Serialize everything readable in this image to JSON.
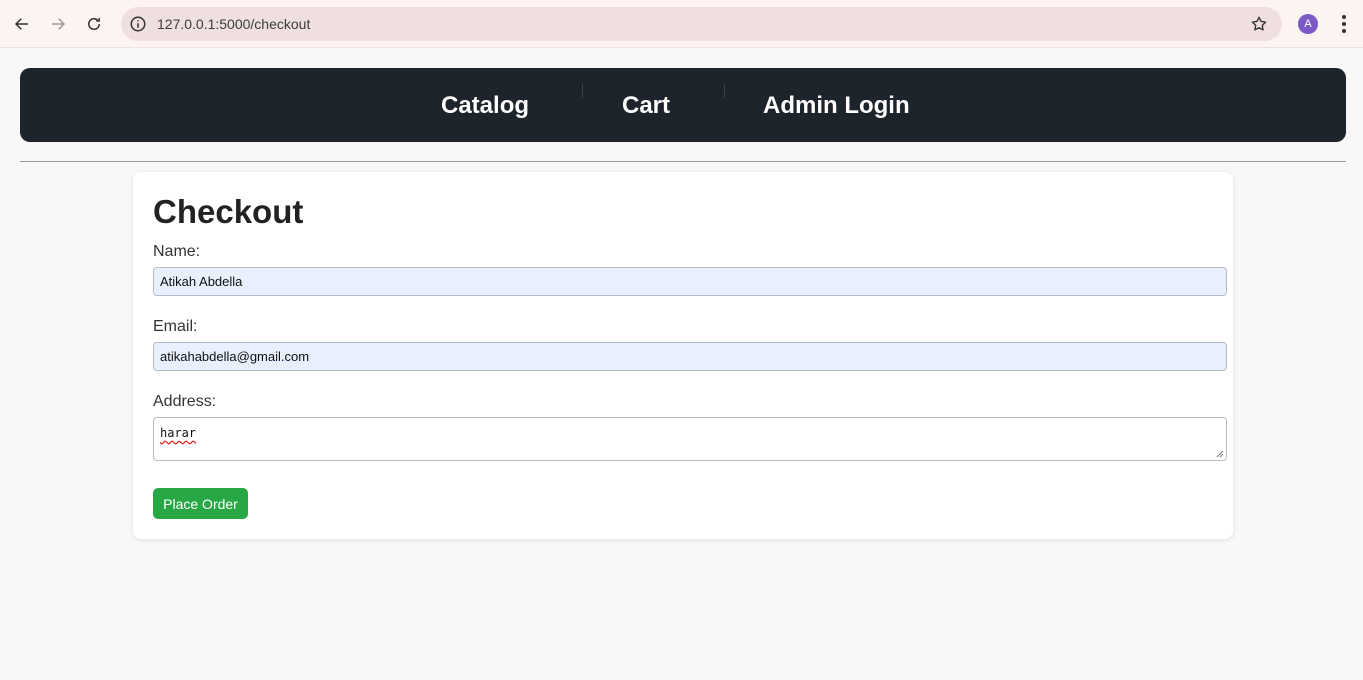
{
  "browser": {
    "url": "127.0.0.1:5000/checkout",
    "avatar_initial": "A"
  },
  "nav": {
    "items": [
      {
        "label": "Catalog"
      },
      {
        "label": "Cart"
      },
      {
        "label": "Admin Login"
      }
    ]
  },
  "checkout": {
    "title": "Checkout",
    "name_label": "Name:",
    "name_value": "Atikah Abdella",
    "email_label": "Email:",
    "email_value": "atikahabdella@gmail.com",
    "address_label": "Address:",
    "address_value": "harar",
    "submit_label": "Place Order"
  },
  "colors": {
    "nav_bg": "#1e242c",
    "button": "#28a745",
    "autofill": "#e8f0fe"
  }
}
